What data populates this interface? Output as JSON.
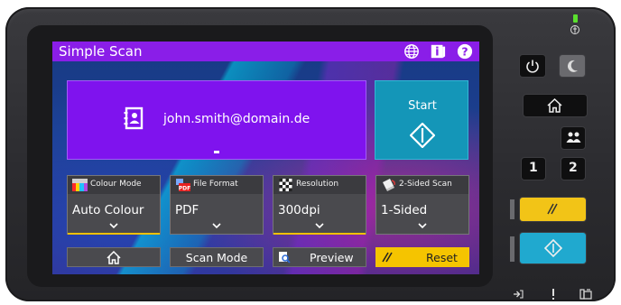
{
  "app": {
    "title": "Simple Scan"
  },
  "titlebar_icons": [
    "globe-icon",
    "info-icon",
    "help-icon"
  ],
  "destination": {
    "email": "john.smith@domain.de",
    "cursor": "-"
  },
  "start": {
    "label": "Start"
  },
  "settings": [
    {
      "label": "Colour Mode",
      "value": "Auto Colour",
      "icon": "colour-mode-icon"
    },
    {
      "label": "File Format",
      "value": "PDF",
      "icon": "pdf-file-icon"
    },
    {
      "label": "Resolution",
      "value": "300dpi",
      "icon": "resolution-icon"
    },
    {
      "label": "2-Sided Scan",
      "value": "1-Sided",
      "icon": "duplex-icon"
    }
  ],
  "bottom": {
    "home": "home-icon",
    "scan_mode": "Scan Mode",
    "preview": "Preview",
    "reset": "Reset"
  },
  "hardware": {
    "copy_one": "1",
    "copy_two": "2"
  },
  "colors": {
    "titlebar": "#8a1ee8",
    "email_panel": "#7f13ee",
    "start": "#1496b8",
    "reset": "#f5c400",
    "active_underline": "#f0c000"
  }
}
